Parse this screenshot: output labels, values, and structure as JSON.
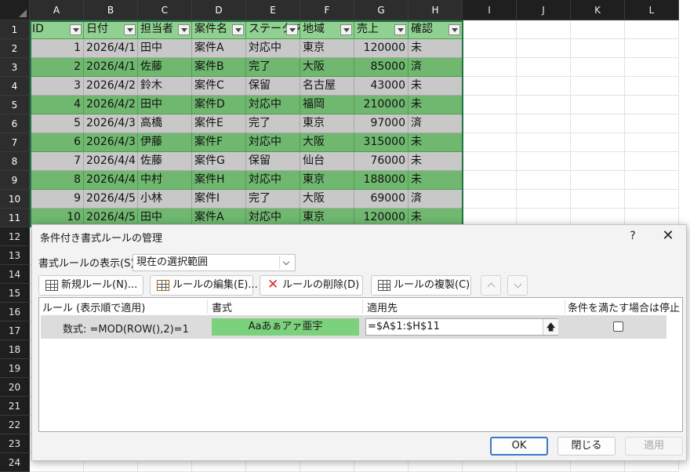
{
  "sheet": {
    "columns": [
      "A",
      "B",
      "C",
      "D",
      "E",
      "F",
      "G",
      "H",
      "I",
      "J",
      "K",
      "L"
    ],
    "rows": [
      "1",
      "2",
      "3",
      "4",
      "5",
      "6",
      "7",
      "8",
      "9",
      "10",
      "11",
      "12",
      "13",
      "14",
      "15",
      "16",
      "17",
      "18",
      "19",
      "20",
      "21",
      "22",
      "23",
      "24"
    ],
    "header_row": [
      "ID",
      "日付",
      "担当者",
      "案件名",
      "ステータス",
      "地域",
      "売上",
      "確認"
    ],
    "data": [
      [
        "1",
        "2026/4/1",
        "田中",
        "案件A",
        "対応中",
        "東京",
        "120000",
        "未"
      ],
      [
        "2",
        "2026/4/1",
        "佐藤",
        "案件B",
        "完了",
        "大阪",
        "85000",
        "済"
      ],
      [
        "3",
        "2026/4/2",
        "鈴木",
        "案件C",
        "保留",
        "名古屋",
        "43000",
        "未"
      ],
      [
        "4",
        "2026/4/2",
        "田中",
        "案件D",
        "対応中",
        "福岡",
        "210000",
        "未"
      ],
      [
        "5",
        "2026/4/3",
        "高橋",
        "案件E",
        "完了",
        "東京",
        "97000",
        "済"
      ],
      [
        "6",
        "2026/4/3",
        "伊藤",
        "案件F",
        "対応中",
        "大阪",
        "315000",
        "未"
      ],
      [
        "7",
        "2026/4/4",
        "佐藤",
        "案件G",
        "保留",
        "仙台",
        "76000",
        "未"
      ],
      [
        "8",
        "2026/4/4",
        "中村",
        "案件H",
        "対応中",
        "東京",
        "188000",
        "未"
      ],
      [
        "9",
        "2026/4/5",
        "小林",
        "案件I",
        "完了",
        "大阪",
        "69000",
        "済"
      ],
      [
        "10",
        "2026/4/5",
        "田中",
        "案件A",
        "対応中",
        "東京",
        "120000",
        "未"
      ]
    ],
    "colors": {
      "green_row": "#70b870",
      "gray_row": "#c8c8c8",
      "header_row": "#90d090",
      "selection": "#217346"
    }
  },
  "dialog": {
    "title": "条件付き書式ルールの管理",
    "help": "?",
    "close": "✕",
    "show_label": "書式ルールの表示(S):",
    "scope_value": "現在の選択範囲",
    "toolbar": {
      "new_rule": "新規ルール(N)...",
      "edit_rule": "ルールの編集(E)...",
      "delete_rule": "ルールの削除(D)",
      "duplicate_rule": "ルールの複製(C)"
    },
    "columns": {
      "rule": "ルール (表示順で適用)",
      "format": "書式",
      "applies_to": "適用先",
      "stop_if_true": "条件を満たす場合は停止"
    },
    "rule": {
      "text": "数式: =MOD(ROW(),2)=1",
      "preview": "Aaあぁアァ亜宇",
      "preview_color": "#7cd17c",
      "applies_to": "=$A$1:$H$11",
      "stop_if_true": false
    },
    "buttons": {
      "ok": "OK",
      "close": "閉じる",
      "apply": "適用"
    }
  }
}
